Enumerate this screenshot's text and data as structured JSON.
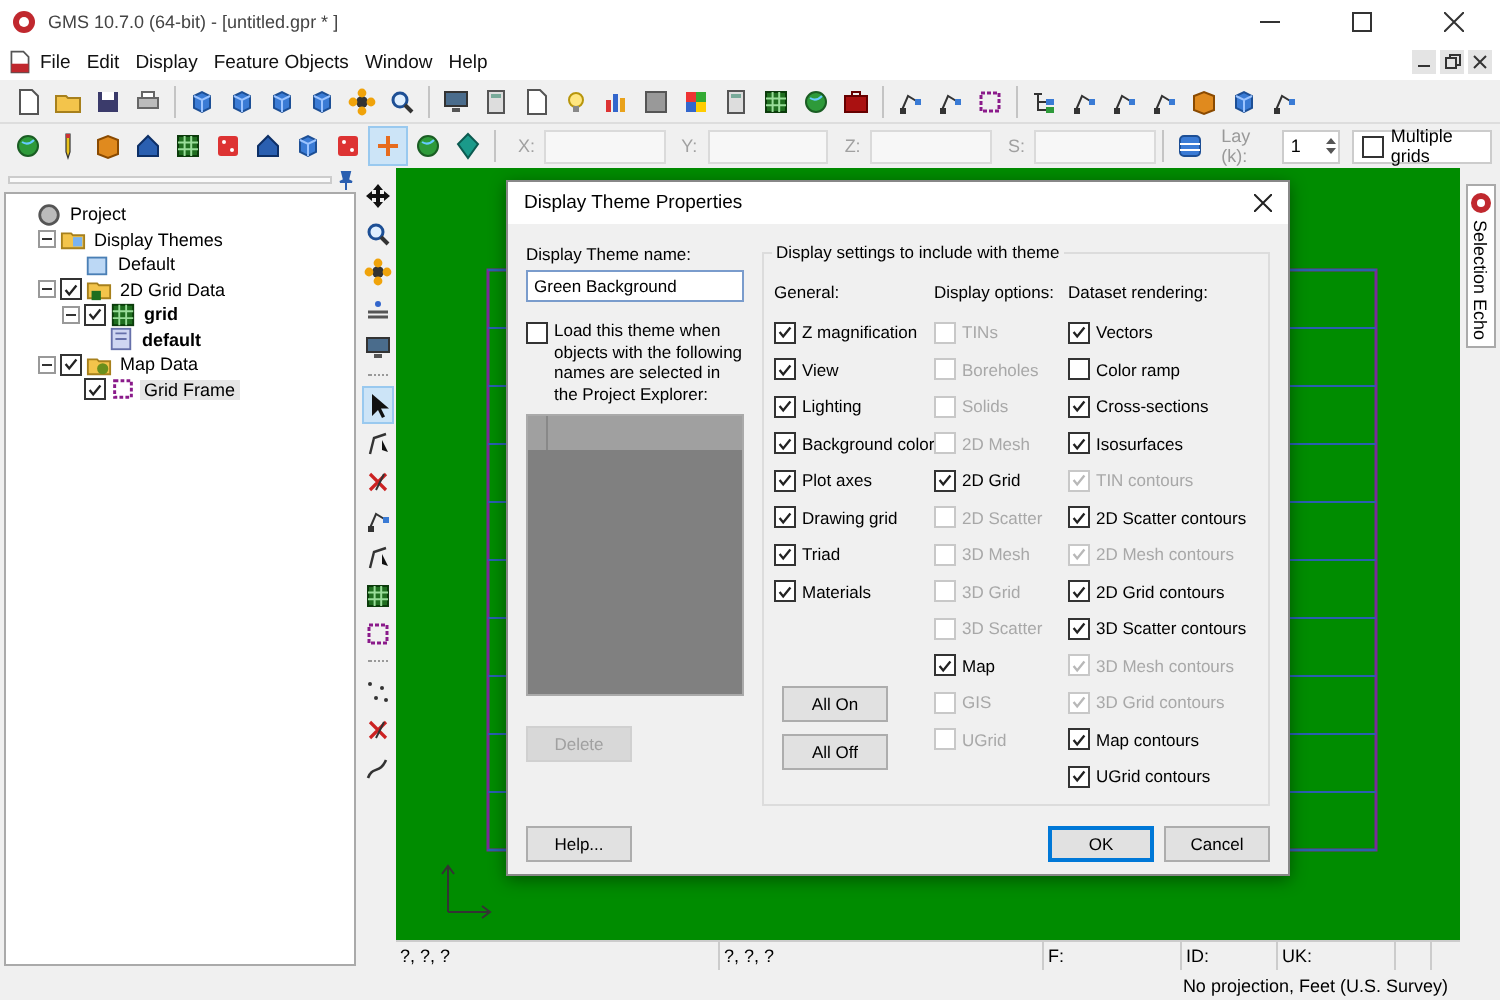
{
  "window": {
    "title": "GMS 10.7.0 (64-bit) - [untitled.gpr * ]"
  },
  "menu": [
    "File",
    "Edit",
    "Display",
    "Feature Objects",
    "Window",
    "Help"
  ],
  "coordinate_bar": {
    "fields": [
      {
        "label": "X:"
      },
      {
        "label": "Y:"
      },
      {
        "label": "Z:"
      },
      {
        "label": "S:"
      }
    ],
    "layer_label": "Lay (k):",
    "layer_value": "1",
    "multiple_grids": {
      "label": "Multiple grids",
      "checked": false
    }
  },
  "project_tree": [
    {
      "label": "Project",
      "kind": "project",
      "bold": false,
      "selected": false,
      "children": [
        {
          "label": "Display Themes",
          "kind": "theme-folder",
          "bold": false,
          "selected": false,
          "children": [
            {
              "label": "Default",
              "kind": "theme",
              "bold": false,
              "selected": false
            }
          ]
        },
        {
          "label": "2D Grid Data",
          "kind": "grid-folder",
          "checked": true,
          "bold": false,
          "selected": false,
          "children": [
            {
              "label": "grid",
              "kind": "grid",
              "checked": true,
              "bold": true,
              "selected": false,
              "children": [
                {
                  "label": "default",
                  "kind": "dataset",
                  "bold": true,
                  "selected": false
                }
              ]
            }
          ]
        },
        {
          "label": "Map Data",
          "kind": "map-folder",
          "checked": true,
          "bold": false,
          "selected": false,
          "children": [
            {
              "label": "Grid Frame",
              "kind": "frame",
              "checked": true,
              "bold": false,
              "selected": true
            }
          ]
        }
      ]
    }
  ],
  "side_tab": "Selection Echo",
  "dialog": {
    "title": "Display Theme Properties",
    "name_label": "Display Theme name:",
    "name_value": "Green Background",
    "load_option": {
      "label": "Load this theme when objects with the following names are selected in the Project Explorer:",
      "checked": false
    },
    "delete_button": {
      "label": "Delete",
      "disabled": true
    },
    "help_button": "Help...",
    "settings_group": {
      "title": "Display settings to include with theme",
      "columns": [
        {
          "heading": "General:",
          "options": [
            {
              "label": "Z magnification",
              "checked": true,
              "disabled": false
            },
            {
              "label": "View",
              "checked": true,
              "disabled": false
            },
            {
              "label": "Lighting",
              "checked": true,
              "disabled": false
            },
            {
              "label": "Background color",
              "checked": true,
              "disabled": false
            },
            {
              "label": "Plot axes",
              "checked": true,
              "disabled": false
            },
            {
              "label": "Drawing grid",
              "checked": true,
              "disabled": false
            },
            {
              "label": "Triad",
              "checked": true,
              "disabled": false
            },
            {
              "label": "Materials",
              "checked": true,
              "disabled": false
            }
          ]
        },
        {
          "heading": "Display options:",
          "options": [
            {
              "label": "TINs",
              "checked": false,
              "disabled": true
            },
            {
              "label": "Boreholes",
              "checked": false,
              "disabled": true
            },
            {
              "label": "Solids",
              "checked": false,
              "disabled": true
            },
            {
              "label": "2D Mesh",
              "checked": false,
              "disabled": true
            },
            {
              "label": "2D Grid",
              "checked": true,
              "disabled": false
            },
            {
              "label": "2D Scatter",
              "checked": false,
              "disabled": true
            },
            {
              "label": "3D Mesh",
              "checked": false,
              "disabled": true
            },
            {
              "label": "3D Grid",
              "checked": false,
              "disabled": true
            },
            {
              "label": "3D Scatter",
              "checked": false,
              "disabled": true
            },
            {
              "label": "Map",
              "checked": true,
              "disabled": false
            },
            {
              "label": "GIS",
              "checked": false,
              "disabled": true
            },
            {
              "label": "UGrid",
              "checked": false,
              "disabled": true
            }
          ]
        },
        {
          "heading": "Dataset rendering:",
          "options": [
            {
              "label": "Vectors",
              "checked": true,
              "disabled": false
            },
            {
              "label": "Color ramp",
              "checked": false,
              "disabled": false
            },
            {
              "label": "Cross-sections",
              "checked": true,
              "disabled": false
            },
            {
              "label": "Isosurfaces",
              "checked": true,
              "disabled": false
            },
            {
              "label": "TIN contours",
              "checked": true,
              "disabled": true
            },
            {
              "label": "2D Scatter contours",
              "checked": true,
              "disabled": false
            },
            {
              "label": "2D Mesh contours",
              "checked": true,
              "disabled": true
            },
            {
              "label": "2D Grid contours",
              "checked": true,
              "disabled": false
            },
            {
              "label": "3D Scatter contours",
              "checked": true,
              "disabled": false
            },
            {
              "label": "3D Mesh contours",
              "checked": true,
              "disabled": true
            },
            {
              "label": "3D Grid contours",
              "checked": true,
              "disabled": true
            },
            {
              "label": "Map contours",
              "checked": true,
              "disabled": false
            },
            {
              "label": "UGrid contours",
              "checked": true,
              "disabled": false
            }
          ]
        }
      ]
    },
    "all_on_button": "All On",
    "all_off_button": "All Off",
    "ok_button": "OK",
    "cancel_button": "Cancel"
  },
  "status_fields": [
    "?, ?, ?",
    "?, ?, ?",
    "F:",
    "ID:",
    "UK:"
  ],
  "status_bar": "No projection, Feet (U.S. Survey)"
}
